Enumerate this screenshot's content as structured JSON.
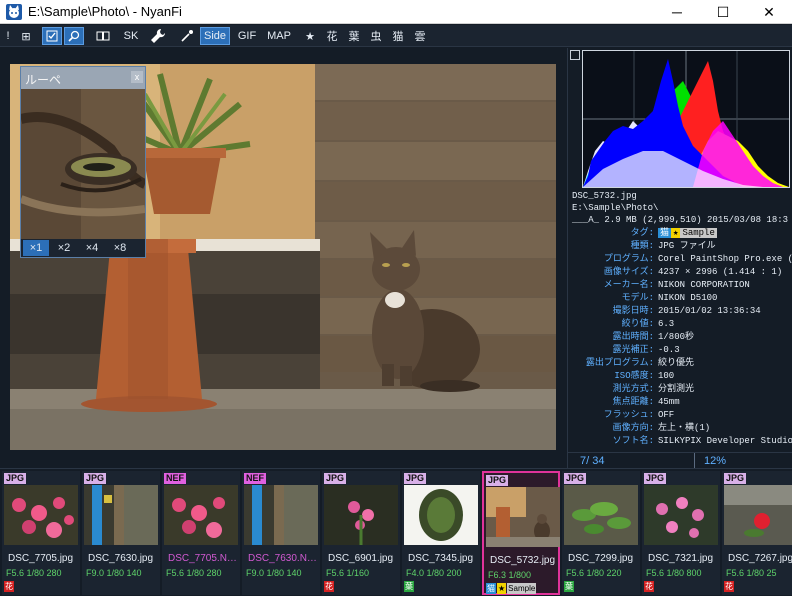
{
  "window": {
    "title": "E:\\Sample\\Photo\\ - NyanFi",
    "min_glyph": "─",
    "max_glyph": "☐",
    "close_glyph": "✕"
  },
  "toolbar": {
    "items": [
      {
        "label": "!",
        "icon": "exclamation-icon"
      },
      {
        "label": "⊞",
        "icon": "grid-icon"
      },
      {
        "label": "",
        "icon": "check-box-icon",
        "selected": true
      },
      {
        "label": "",
        "icon": "magnifier-icon",
        "selected": true
      },
      {
        "label": "",
        "icon": "book-icon"
      },
      {
        "label": "SK",
        "icon": ""
      },
      {
        "label": "",
        "icon": "wrench-icon"
      },
      {
        "label": "",
        "icon": "eyedropper-icon"
      },
      {
        "label": "Side",
        "icon": "",
        "selected": true
      },
      {
        "label": "GIF",
        "icon": ""
      },
      {
        "label": "MAP",
        "icon": ""
      },
      {
        "label": "★",
        "icon": "star-icon"
      },
      {
        "label": "花",
        "icon": ""
      },
      {
        "label": "葉",
        "icon": ""
      },
      {
        "label": "虫",
        "icon": ""
      },
      {
        "label": "猫",
        "icon": ""
      },
      {
        "label": "雲",
        "icon": ""
      }
    ]
  },
  "loupe": {
    "title": "ルーペ",
    "close": "x",
    "zooms": [
      "×1",
      "×2",
      "×4",
      "×8"
    ],
    "selected_zoom": 0
  },
  "info": {
    "filename": "DSC_5732.jpg",
    "path": "E:\\Sample\\Photo\\",
    "attr_line": "___A_   2.9 MB (2,999,510)  2015/03/08 18:3",
    "tag_label": "タグ:",
    "tags": [
      {
        "text": "猫",
        "bg": "#2a8fd6",
        "fg": "#ffffff"
      },
      {
        "text": "★",
        "bg": "#f2d200",
        "fg": "#000000"
      },
      {
        "text": "Sample",
        "bg": "#c8c8c8",
        "fg": "#000000"
      }
    ],
    "rows": [
      {
        "k": "種類:",
        "v": "JPG ファイル"
      },
      {
        "k": "プログラム:",
        "v": "Corel PaintShop Pro.exe  ("
      },
      {
        "k": "画像サイズ:",
        "v": "4237 × 2996  (1.414 : 1)"
      },
      {
        "k": "メーカー名:",
        "v": "NIKON CORPORATION"
      },
      {
        "k": "モデル:",
        "v": "NIKON D5100"
      },
      {
        "k": "撮影日時:",
        "v": "2015/01/02 13:36:34"
      },
      {
        "k": "絞り値:",
        "v": "6.3"
      },
      {
        "k": "露出時間:",
        "v": "1/800秒"
      },
      {
        "k": "露光補正:",
        "v": "-0.3"
      },
      {
        "k": "露出プログラム:",
        "v": "絞り優先"
      },
      {
        "k": "ISO感度:",
        "v": "100"
      },
      {
        "k": "測光方式:",
        "v": "分割測光"
      },
      {
        "k": "焦点距離:",
        "v": "45mm"
      },
      {
        "k": "フラッシュ:",
        "v": "OFF"
      },
      {
        "k": "画像方向:",
        "v": "左上・横(1)"
      },
      {
        "k": "ソフト名:",
        "v": "SILKYPIX Developer Studio"
      }
    ]
  },
  "status": {
    "position": "7/ 34",
    "zoom": "12%"
  },
  "colors": {
    "accent": "#2c6fb8",
    "selected_border": "#e0339a",
    "label_blue": "#5fb0ff",
    "exif_green": "#5ed36a",
    "nef_magenta": "#cc44cc"
  },
  "thumbnails": [
    {
      "type": "JPG",
      "name": "DSC_7705.jpg",
      "exif": "F5.6 1/80 280",
      "name_color": "#e6edf5",
      "badges": [
        {
          "t": "花",
          "bg": "#d42020"
        }
      ],
      "scene": "pinkflowers"
    },
    {
      "type": "JPG",
      "name": "DSC_7630.jpg",
      "exif": "F9.0 1/80 140",
      "name_color": "#e6edf5",
      "badges": [],
      "scene": "wall"
    },
    {
      "type": "NEF",
      "name": "DSC_7705.N…",
      "exif": "F5.6 1/80 280",
      "name_color": "#d25ad2",
      "badges": [],
      "scene": "pinkflowers"
    },
    {
      "type": "NEF",
      "name": "DSC_7630.N…",
      "exif": "F9.0 1/80 140",
      "name_color": "#d25ad2",
      "badges": [],
      "scene": "wall"
    },
    {
      "type": "JPG",
      "name": "DSC_6901.jpg",
      "exif": "F5.6 1/160",
      "name_color": "#e6edf5",
      "badges": [
        {
          "t": "花",
          "bg": "#d42020"
        }
      ],
      "scene": "pinkplant"
    },
    {
      "type": "JPG",
      "name": "DSC_7345.jpg",
      "exif": "F4.0 1/80 200",
      "name_color": "#e6edf5",
      "badges": [
        {
          "t": "葉",
          "bg": "#2aa640"
        }
      ],
      "scene": "vignette"
    },
    {
      "type": "JPG",
      "name": "DSC_5732.jpg",
      "exif": "F6.3 1/800",
      "name_color": "#e6edf5",
      "badges": [
        {
          "t": "猫",
          "bg": "#2a8fd6"
        },
        {
          "t": "★",
          "bg": "#f2d200"
        },
        {
          "t": "Sample",
          "bg": "#c8c8c8"
        }
      ],
      "scene": "cat",
      "selected": true
    },
    {
      "type": "JPG",
      "name": "DSC_7299.jpg",
      "exif": "F5.6 1/80 220",
      "name_color": "#e6edf5",
      "badges": [
        {
          "t": "葉",
          "bg": "#2aa640"
        }
      ],
      "scene": "greenleaves"
    },
    {
      "type": "JPG",
      "name": "DSC_7321.jpg",
      "exif": "F5.6 1/80 800",
      "name_color": "#e6edf5",
      "badges": [
        {
          "t": "花",
          "bg": "#d42020"
        }
      ],
      "scene": "pinkflowers2"
    },
    {
      "type": "JPG",
      "name": "DSC_7267.jpg",
      "exif": "F5.6 1/80 25",
      "name_color": "#e6edf5",
      "badges": [
        {
          "t": "花",
          "bg": "#d42020"
        }
      ],
      "scene": "redflower"
    }
  ]
}
